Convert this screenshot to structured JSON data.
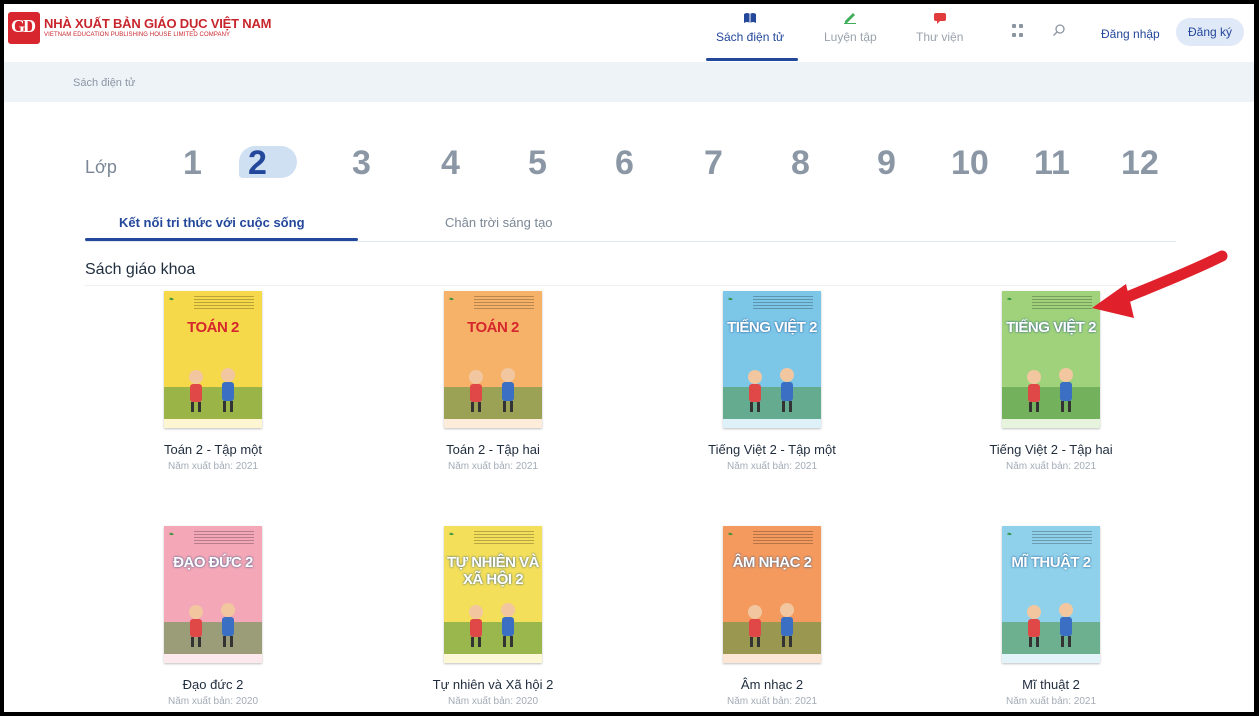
{
  "header": {
    "logo_title": "NHÀ XUẤT BẢN GIÁO DỤC VIỆT NAM",
    "logo_subtitle": "VIETNAM EDUCATION PUBLISHING HOUSE LIMITED COMPANY",
    "logo_mark": "GD",
    "nav": [
      {
        "label": "Sách điện tử",
        "icon": "book-icon",
        "active": true
      },
      {
        "label": "Luyện tập",
        "icon": "pencil-icon",
        "active": false
      },
      {
        "label": "Thư viện",
        "icon": "chat-icon",
        "active": false
      }
    ],
    "login_label": "Đăng nhập",
    "register_label": "Đăng ký",
    "colors": {
      "brand": "#23479b",
      "logo_red": "#d7262d"
    }
  },
  "breadcrumb": "Sách điện tử",
  "grades": {
    "label": "Lớp",
    "items": [
      "1",
      "2",
      "3",
      "4",
      "5",
      "6",
      "7",
      "8",
      "9",
      "10",
      "11",
      "12"
    ],
    "active": "2"
  },
  "tabs": [
    {
      "label": "Kết nối tri thức với cuộc sống",
      "active": true
    },
    {
      "label": "Chân trời sáng tạo",
      "active": false
    }
  ],
  "section_title": "Sách giáo khoa",
  "books": [
    {
      "title": "Toán 2 - Tập một",
      "year": "Năm xuất bản: 2021",
      "cover_title": "TOÁN 2",
      "cover_color": "#f6d94a"
    },
    {
      "title": "Toán 2 - Tập hai",
      "year": "Năm xuất bản: 2021",
      "cover_title": "TOÁN 2",
      "cover_color": "#f7b26a"
    },
    {
      "title": "Tiếng Việt 2 - Tập một",
      "year": "Năm xuất bản: 2021",
      "cover_title": "TIẾNG VIỆT 2",
      "cover_color": "#7cc6e8"
    },
    {
      "title": "Tiếng Việt 2 - Tập hai",
      "year": "Năm xuất bản: 2021",
      "cover_title": "TIẾNG VIỆT 2",
      "cover_color": "#9fd27a"
    },
    {
      "title": "Đạo đức 2",
      "year": "Năm xuất bản: 2020",
      "cover_title": "ĐẠO ĐỨC 2",
      "cover_color": "#f4a7b6"
    },
    {
      "title": "Tự nhiên và Xã hội 2",
      "year": "Năm xuất bản: 2020",
      "cover_title": "TỰ NHIÊN VÀ XÃ HỘI 2",
      "cover_color": "#f3df5a"
    },
    {
      "title": "Âm nhạc 2",
      "year": "Năm xuất bản: 2021",
      "cover_title": "ÂM NHẠC 2",
      "cover_color": "#f49a5e"
    },
    {
      "title": "Mĩ thuật 2",
      "year": "Năm xuất bản: 2021",
      "cover_title": "MĨ THUẬT 2",
      "cover_color": "#8fd0ea"
    }
  ],
  "annotation": {
    "arrow_color": "#e0202a"
  }
}
